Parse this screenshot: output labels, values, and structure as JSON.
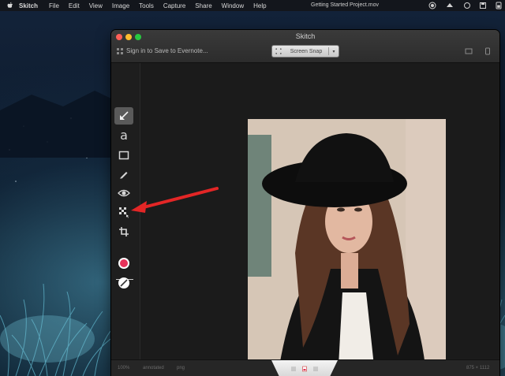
{
  "menubar": {
    "app": "Skitch",
    "items": [
      "File",
      "Edit",
      "View",
      "Image",
      "Tools",
      "Capture",
      "Share",
      "Window",
      "Help"
    ],
    "document_title": "Getting Started Project.mov"
  },
  "window": {
    "title": "Skitch",
    "evernote_label": "Sign in to Save to Evernote...",
    "snap_button_label": "Screen Snap"
  },
  "toolbar": {
    "tools": [
      "arrow-tool",
      "text-tool",
      "shape-tool",
      "pen-tool",
      "highlight-tool",
      "pixelate-tool",
      "crop-tool"
    ],
    "text_tool_glyph": "a",
    "color": "#e8325a"
  },
  "bottombar": {
    "zoom": "100%",
    "mode": "annotated",
    "format": "png",
    "size": "875 × 1112"
  },
  "annotation": {
    "arrow_color": "#e32626"
  }
}
